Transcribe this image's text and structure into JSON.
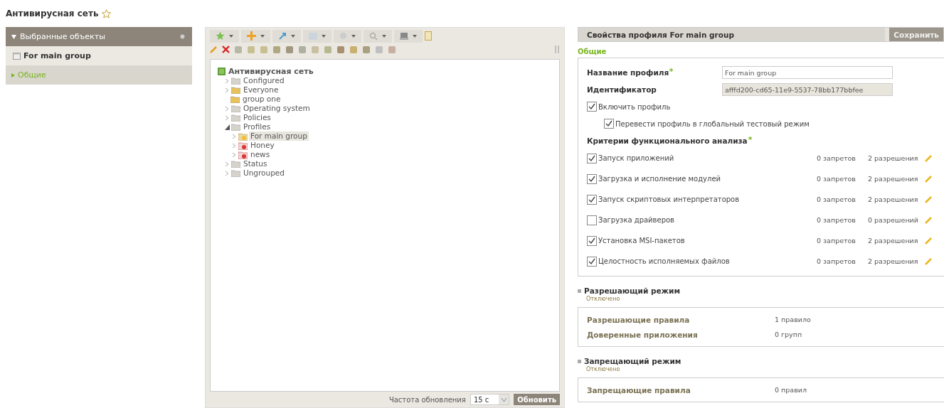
{
  "page_title": "Антивирусная сеть",
  "favorite": false,
  "left_panel": {
    "header": "Выбранные объекты",
    "expanded": true,
    "items": [
      {
        "kind": "object",
        "label": "For main group",
        "selected": false
      },
      {
        "kind": "section",
        "label": "Общие",
        "selected": true
      }
    ]
  },
  "tree": {
    "items": [
      {
        "kind": "network",
        "label": "Антивирусная сеть",
        "selected": false,
        "children": [
          {
            "kind": "folder",
            "label": "Configured",
            "expanded": false,
            "selected": false
          },
          {
            "kind": "folder-yellow",
            "label": "Everyone",
            "expanded": false,
            "selected": false
          },
          {
            "kind": "folder-yellow",
            "label": "group one",
            "selected": false
          },
          {
            "kind": "folder",
            "label": "Operating system",
            "expanded": false,
            "selected": false
          },
          {
            "kind": "folder",
            "label": "Policies",
            "expanded": false,
            "selected": false
          },
          {
            "kind": "folder",
            "label": "Profiles",
            "expanded": true,
            "selected": false,
            "children": [
              {
                "kind": "profile",
                "label": "For main group",
                "expanded": false,
                "selected": true
              },
              {
                "kind": "profile-off",
                "label": "Honey",
                "expanded": false,
                "selected": false
              },
              {
                "kind": "profile-off",
                "label": "news",
                "expanded": false,
                "selected": false
              }
            ]
          },
          {
            "kind": "folder",
            "label": "Status",
            "expanded": false,
            "selected": false
          },
          {
            "kind": "folder",
            "label": "Ungrouped",
            "expanded": false,
            "selected": false
          }
        ]
      }
    ]
  },
  "refresh": {
    "label": "Частота обновления",
    "value": "15 с",
    "button": "Обновить"
  },
  "properties": {
    "title": "Свойства профиля For main group",
    "save_button": "Сохранить",
    "section": "Общие",
    "fields": [
      {
        "label": "Название профиля",
        "required": true,
        "value": "For main group",
        "disabled": false
      },
      {
        "label": "Идентификатор",
        "required": false,
        "value": "afffd200-cd65-11e9-5537-78bb177bbfee",
        "disabled": true
      }
    ],
    "options": [
      {
        "label": "Включить профиль",
        "checked": true,
        "nested": false
      },
      {
        "label": "Перевести профиль в глобальный тестовый режим",
        "checked": true,
        "nested": true
      }
    ],
    "criteria_title": "Критерии функционального анализа",
    "criteria_required": true,
    "criteria": [
      {
        "label": "Запуск приложений",
        "checked": true,
        "denials": "0 запретов",
        "permissions": "2 разрешения"
      },
      {
        "label": "Загрузка и исполнение модулей",
        "checked": true,
        "denials": "0 запретов",
        "permissions": "2 разрешения"
      },
      {
        "label": "Запуск скриптовых интерпретаторов",
        "checked": true,
        "denials": "0 запретов",
        "permissions": "2 разрешения"
      },
      {
        "label": "Загрузка драйверов",
        "checked": false,
        "denials": "0 запретов",
        "permissions": "0 разрешений"
      },
      {
        "label": "Установка MSI-пакетов",
        "checked": true,
        "denials": "0 запретов",
        "permissions": "2 разрешения"
      },
      {
        "label": "Целостность исполняемых файлов",
        "checked": true,
        "denials": "0 запретов",
        "permissions": "2 разрешения"
      }
    ]
  },
  "modes": [
    {
      "title": "Разрешающий режим",
      "status": "Отключено",
      "rows": [
        {
          "label": "Разрешающие правила",
          "value": "1 правило"
        },
        {
          "label": "Доверенные приложения",
          "value": "0 групп"
        }
      ]
    },
    {
      "title": "Запрещающий режим",
      "status": "Отключено",
      "rows": [
        {
          "label": "Запрещающие правила",
          "value": "0 правил"
        }
      ]
    }
  ]
}
